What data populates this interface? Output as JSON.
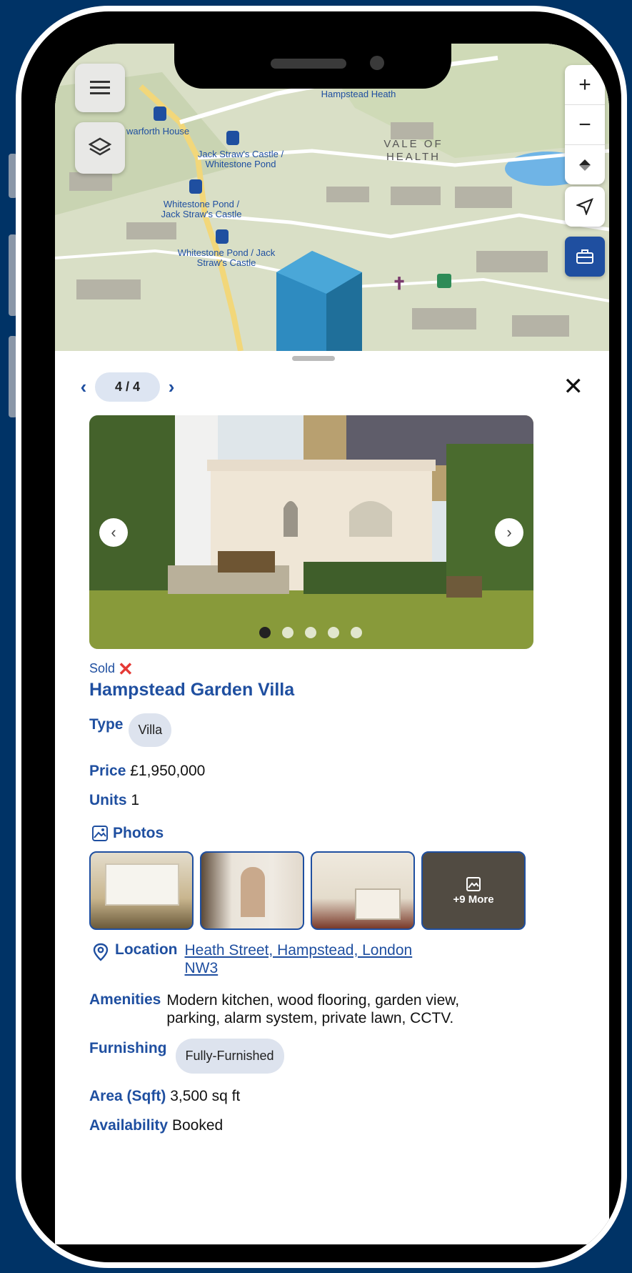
{
  "map": {
    "labels": {
      "hampstead_heath": "Hampstead Heath",
      "heathforth_house": "warforth House",
      "jack_straws_1": "Jack Straw's Castle / Whitestone Pond",
      "whitestone_1": "Whitestone Pond / Jack Straw's Castle",
      "whitestone_2": "Whitestone Pond / Jack Straw's Castle",
      "vale_of_health": "VALE OF HEALTH"
    },
    "controls": {
      "zoom_in": "+",
      "zoom_out": "−"
    }
  },
  "pager": {
    "label": "4 / 4"
  },
  "carousel": {
    "slide_count": 5,
    "active_index": 0
  },
  "property": {
    "status": "Sold",
    "title": "Hampstead Garden Villa",
    "type_label": "Type",
    "type_value": "Villa",
    "price_label": "Price",
    "price_value": "£1,950,000",
    "units_label": "Units",
    "units_value": "1",
    "photos_label": "Photos",
    "more_photos": "+9 More",
    "location_label": "Location",
    "location_line1": "Heath Street, Hampstead, London",
    "location_line2": "NW3",
    "amenities_label": "Amenities",
    "amenities_line1": "Modern kitchen, wood flooring, garden view,",
    "amenities_line2": "parking, alarm system, private lawn, CCTV.",
    "furnishing_label": "Furnishing",
    "furnishing_value": "Fully-Furnished",
    "area_label": "Area (Sqft)",
    "area_value": "3,500 sq ft",
    "availability_label": "Availability",
    "availability_value": "Booked"
  },
  "colors": {
    "accent": "#1f4fa0",
    "frame": "#003366",
    "sold_x": "#e53935"
  }
}
